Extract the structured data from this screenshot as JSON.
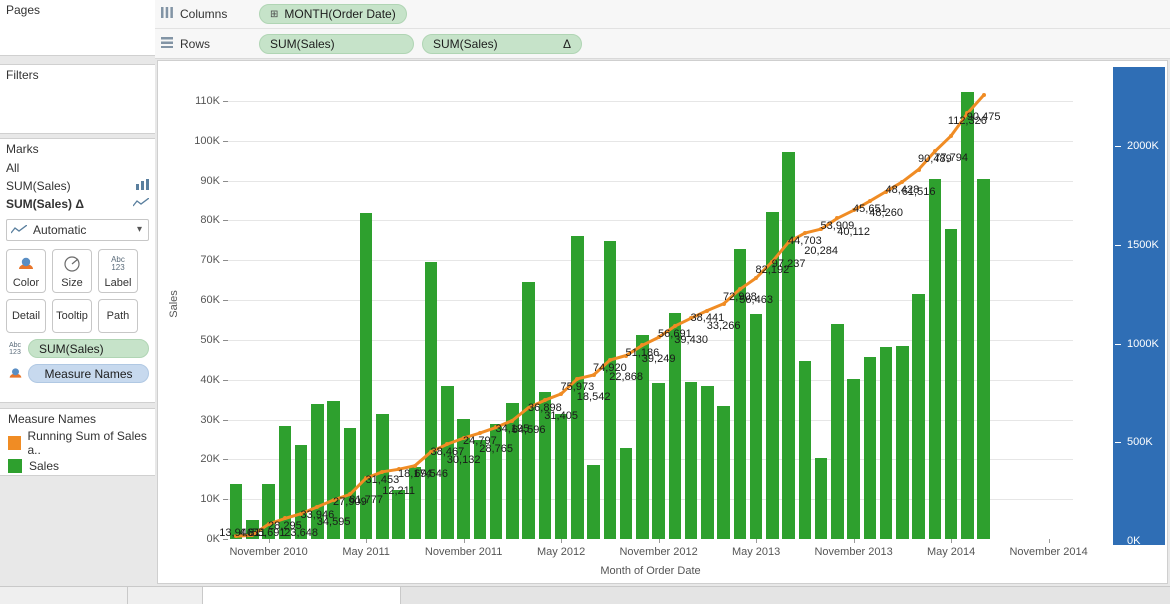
{
  "sidebar": {
    "pages": {
      "title": "Pages"
    },
    "filters": {
      "title": "Filters"
    },
    "marks": {
      "title": "Marks",
      "all_label": "All",
      "rows": [
        {
          "label": "SUM(Sales)",
          "icon": "bar-mark-icon"
        },
        {
          "label": "SUM(Sales)  Δ",
          "icon": "line-mark-icon"
        }
      ],
      "row1_label": "SUM(Sales)",
      "row2_label": "SUM(Sales)",
      "row2_delta": "Δ",
      "mark_type": "Automatic",
      "buttons": [
        {
          "label": "Color",
          "icon": "color-icon"
        },
        {
          "label": "Size",
          "icon": "size-icon"
        },
        {
          "label": "Label",
          "icon": "label-icon"
        }
      ],
      "buttons2": [
        {
          "label": "Detail",
          "icon": "detail-icon"
        },
        {
          "label": "Tooltip",
          "icon": "tooltip-icon"
        },
        {
          "label": "Path",
          "icon": "path-icon"
        }
      ],
      "pills": [
        {
          "label": "SUM(Sales)",
          "icon": "abc123-icon",
          "color": "green"
        },
        {
          "label": "Measure Names",
          "icon": "color-icon",
          "color": "blue"
        }
      ]
    },
    "legend": {
      "title": "Measure Names",
      "items": [
        {
          "label": "Running Sum of Sales a..",
          "color": "#f08c24"
        },
        {
          "label": "Sales",
          "color": "#2ea02e"
        }
      ]
    }
  },
  "shelves": {
    "columns_label": "Columns",
    "rows_label": "Rows",
    "columns_pills": [
      {
        "label": "MONTH(Order Date)",
        "expand": "⊞"
      }
    ],
    "rows_pills": [
      {
        "label": "SUM(Sales)",
        "delta": ""
      },
      {
        "label": "SUM(Sales)",
        "delta": "Δ"
      }
    ]
  },
  "chart_data": {
    "type": "bar",
    "title": "",
    "xlabel": "Month of Order Date",
    "ylabel": "Sales",
    "y2label": "Running Sum of Sales",
    "ylim": [
      0,
      118000
    ],
    "y2lim": [
      0,
      2350000
    ],
    "yticks": [
      "0K",
      "10K",
      "20K",
      "30K",
      "40K",
      "50K",
      "60K",
      "70K",
      "80K",
      "90K",
      "100K",
      "110K"
    ],
    "ytick_values": [
      0,
      10000,
      20000,
      30000,
      40000,
      50000,
      60000,
      70000,
      80000,
      90000,
      100000,
      110000
    ],
    "y2ticks": [
      "0K",
      "500K",
      "1000K",
      "1500K",
      "2000K"
    ],
    "y2tick_values": [
      0,
      500000,
      1000000,
      1500000,
      2000000
    ],
    "xticks": [
      "November 2010",
      "May 2011",
      "November 2011",
      "May 2012",
      "November 2012",
      "May 2013",
      "November 2013",
      "May 2014",
      "November 2014"
    ],
    "xtick_index": [
      2,
      8,
      14,
      20,
      26,
      32,
      38,
      44,
      50
    ],
    "grid": true,
    "legend_position": "sidebar",
    "categories": [
      "September 2010",
      "October 2010",
      "November 2010",
      "December 2010",
      "January 2011",
      "February 2011",
      "March 2011",
      "April 2011",
      "May 2011",
      "June 2011",
      "July 2011",
      "August 2011",
      "September 2011",
      "October 2011",
      "November 2011",
      "December 2011",
      "January 2012",
      "February 2012",
      "March 2012",
      "April 2012",
      "May 2012",
      "June 2012",
      "July 2012",
      "August 2012",
      "September 2012",
      "October 2012",
      "November 2012",
      "December 2012",
      "January 2013",
      "February 2013",
      "March 2013",
      "April 2013",
      "May 2013",
      "June 2013",
      "July 2013",
      "August 2013",
      "September 2013",
      "October 2013",
      "November 2013",
      "December 2013",
      "January 2014",
      "February 2014",
      "March 2014",
      "April 2014",
      "May 2014",
      "June 2014",
      "July 2014",
      "August 2014",
      "September 2014",
      "October 2014",
      "November 2014",
      "December 2014"
    ],
    "series": [
      {
        "name": "Sales",
        "type": "bar",
        "color": "#2ea02e",
        "axis": "left",
        "values": [
          13946,
          4811,
          55691,
          28295,
          23648,
          33946,
          34595,
          27909,
          81777,
          31453,
          12211,
          18174,
          69546,
          38467,
          30132,
          24797,
          28765,
          34195,
          64596,
          36898,
          31405,
          75973,
          18542,
          74920,
          22868,
          51186,
          39249,
          56691,
          39430,
          38441,
          33266,
          72908,
          56463,
          82192,
          97237,
          44703,
          20284,
          53909,
          40112,
          45651,
          48260,
          48428,
          61516,
          90489,
          77794,
          112326,
          90475,
          0,
          0,
          0,
          0,
          0
        ],
        "bar_heights_k": [
          13.9,
          4.8,
          13.9,
          28.3,
          23.6,
          33.9,
          34.6,
          27.9,
          81.8,
          31.5,
          12.2,
          18.2,
          69.5,
          38.5,
          30.1,
          24.8,
          28.8,
          34.2,
          64.6,
          36.9,
          31.4,
          76.0,
          18.5,
          74.9,
          22.9,
          51.2,
          39.2,
          56.7,
          39.4,
          38.4,
          33.3,
          72.9,
          56.5,
          82.2,
          97.2,
          44.7,
          20.3,
          53.9,
          40.1,
          45.7,
          48.3,
          48.4,
          61.5,
          90.5,
          77.8,
          112.3,
          90.5
        ]
      },
      {
        "name": "Running Sum of Sales",
        "type": "line",
        "color": "#f08c24",
        "axis": "right",
        "labels": [
          "13,946",
          "4,811",
          "55,691",
          "28,295",
          "23,648",
          "33,946",
          "34,595",
          "27,909",
          "81,777",
          "31,453",
          "12,211",
          "18,174",
          "69,546",
          "38,467",
          "30,132",
          "24,797",
          "28,765",
          "34,195",
          "64,596",
          "36,898",
          "31,405",
          "75,973",
          "18,542",
          "74,920",
          "22,868",
          "51,186",
          "39,249",
          "56,691",
          "39,430",
          "38,441",
          "33,266",
          "72,908",
          "56,463",
          "82,192",
          "97,237",
          "44,703",
          "20,284",
          "53,909",
          "40,112",
          "45,651",
          "48,260",
          "48,428",
          "61,516",
          "90,489",
          "77,794",
          "112,326",
          "90,475"
        ]
      }
    ]
  },
  "colors": {
    "bar_green": "#2ea02e",
    "line_orange": "#f08c24",
    "axis_highlight_blue": "#2f6eb5",
    "pill_green": "#c6e3c9",
    "pill_blue": "#c7d9ee"
  }
}
